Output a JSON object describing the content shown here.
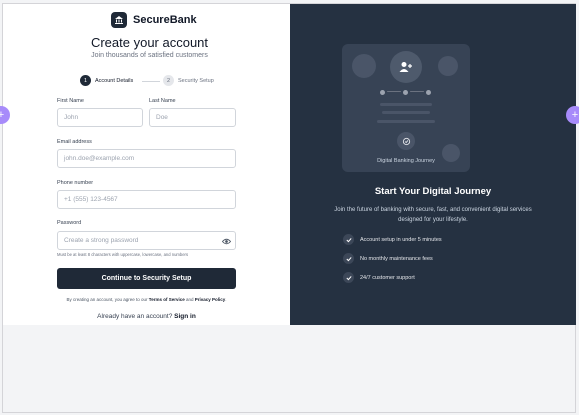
{
  "brand": {
    "name": "SecureBank"
  },
  "form": {
    "title": "Create your account",
    "subtitle": "Join thousands of satisfied customers",
    "steps": [
      {
        "num": "1",
        "label": "Account Details"
      },
      {
        "num": "2",
        "label": "Security Setup"
      }
    ],
    "first_name": {
      "label": "First Name",
      "placeholder": "John"
    },
    "last_name": {
      "label": "Last Name",
      "placeholder": "Doe"
    },
    "email": {
      "label": "Email address",
      "placeholder": "john.doe@example.com"
    },
    "phone": {
      "label": "Phone number",
      "placeholder": "+1 (555) 123-4567"
    },
    "password": {
      "label": "Password",
      "placeholder": "Create a strong password",
      "hint": "Must be at least 8 characters with uppercase, lowercase, and numbers"
    },
    "submit_label": "Continue to Security Setup",
    "terms_prefix": "By creating an account, you agree to our ",
    "terms_link": "Terms of Service",
    "terms_and": " and ",
    "privacy_link": "Privacy Policy",
    "terms_suffix": ".",
    "signin_prompt": "Already have an account? ",
    "signin_link": "Sign in"
  },
  "promo": {
    "card_caption": "Digital Banking Journey",
    "title": "Start Your Digital Journey",
    "description": "Join the future of banking with secure, fast, and convenient digital services designed for your lifestyle.",
    "features": [
      "Account setup in under 5 minutes",
      "No monthly maintenance fees",
      "24/7 customer support"
    ]
  },
  "colors": {
    "accent": "#1f2937",
    "panel": "#253141",
    "handle": "#a78bfa"
  },
  "icons": {
    "logo": "bank-icon",
    "eye": "eye-icon",
    "check": "check-icon",
    "add_user": "user-plus-icon",
    "handle": "plus-icon"
  }
}
